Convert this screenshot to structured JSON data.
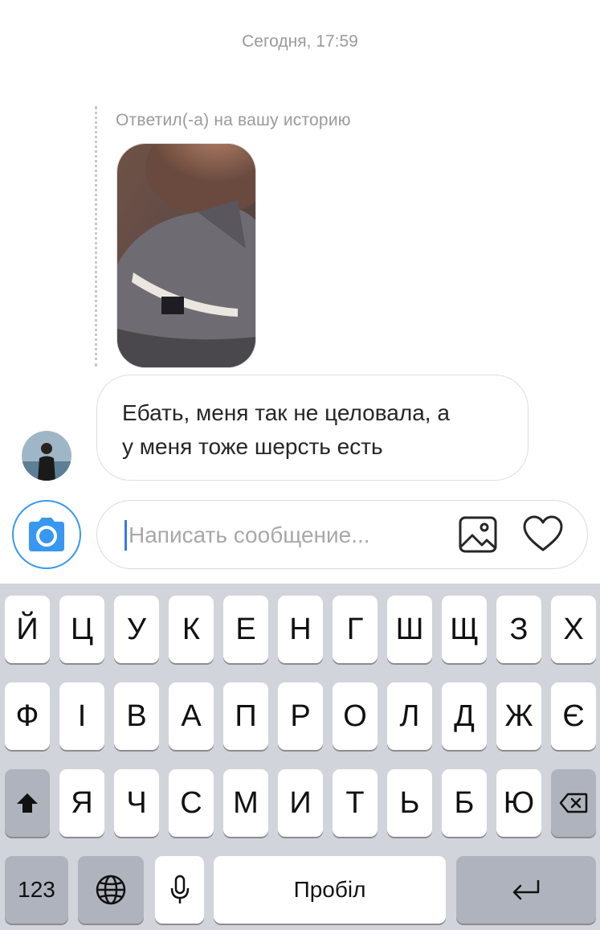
{
  "chat": {
    "timestamp": "Сегодня, 17:59",
    "reply_label": "Ответил(-а) на вашу историю",
    "story_image": "cat-photo",
    "message": {
      "line1": "Ебать, меня так не целовала, а",
      "line2": "у меня тоже шерсть есть"
    }
  },
  "composer": {
    "placeholder": "Написать сообщение...",
    "icons": [
      "camera-icon",
      "gallery-icon",
      "heart-icon"
    ],
    "accent": "#3897f0"
  },
  "keyboard": {
    "row1": [
      "Й",
      "Ц",
      "У",
      "К",
      "Е",
      "Н",
      "Г",
      "Ш",
      "Щ",
      "З",
      "Х"
    ],
    "row2": [
      "Ф",
      "І",
      "В",
      "А",
      "П",
      "Р",
      "О",
      "Л",
      "Д",
      "Ж",
      "Є"
    ],
    "row3": [
      "Я",
      "Ч",
      "С",
      "М",
      "И",
      "Т",
      "Ь",
      "Б",
      "Ю"
    ],
    "numbers_label": "123",
    "space_label": "Пробіл",
    "icons": [
      "shift-icon",
      "backspace-icon",
      "globe-icon",
      "microphone-icon",
      "return-icon"
    ]
  }
}
